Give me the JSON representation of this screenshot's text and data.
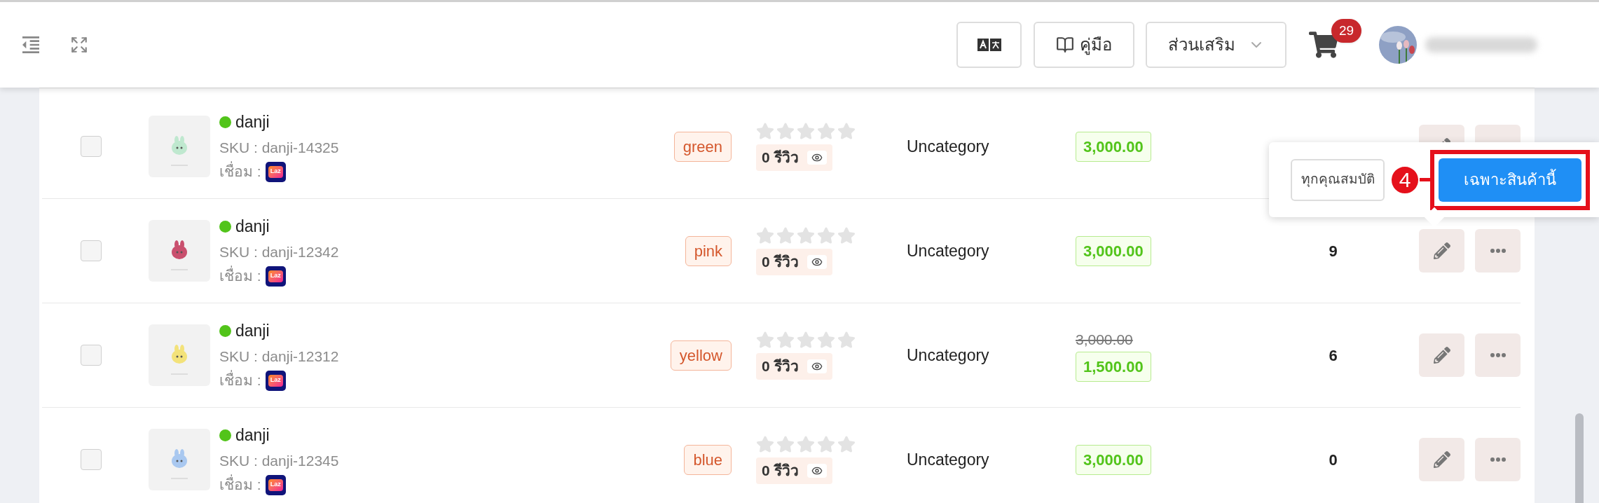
{
  "topbar": {
    "guide_label": "คู่มือ",
    "addons_label": "ส่วนเสริม",
    "cart_count": "29"
  },
  "rows": [
    {
      "checked": false,
      "name": "danji",
      "sku": "SKU : danji-14325",
      "linked_label": "เชื่อม :",
      "shop_badge": "Laz",
      "variant": "green",
      "stars": 0,
      "reviews": "0 รีวิว",
      "category": "Uncategory",
      "price": "3,000.00"
    },
    {
      "checked": false,
      "name": "danji",
      "sku": "SKU : danji-12342",
      "linked_label": "เชื่อม :",
      "shop_badge": "Laz",
      "variant": "pink",
      "stars": 0,
      "reviews": "0 รีวิว",
      "category": "Uncategory",
      "price": "3,000.00",
      "qty": "9"
    },
    {
      "checked": false,
      "name": "danji",
      "sku": "SKU : danji-12312",
      "linked_label": "เชื่อม :",
      "shop_badge": "Laz",
      "variant": "yellow",
      "stars": 0,
      "reviews": "0 รีวิว",
      "category": "Uncategory",
      "old_price": "3,000.00",
      "price": "1,500.00",
      "qty": "6"
    },
    {
      "checked": false,
      "name": "danji",
      "sku": "SKU : danji-12345",
      "linked_label": "เชื่อม :",
      "shop_badge": "Laz",
      "variant": "blue",
      "stars": 0,
      "reviews": "0 รีวิว",
      "category": "Uncategory",
      "price": "3,000.00",
      "qty": "0"
    }
  ],
  "popup": {
    "all_label": "ทุกคุณสมบัติ",
    "this_label": "เฉพาะสินค้านี้",
    "step": "4"
  }
}
